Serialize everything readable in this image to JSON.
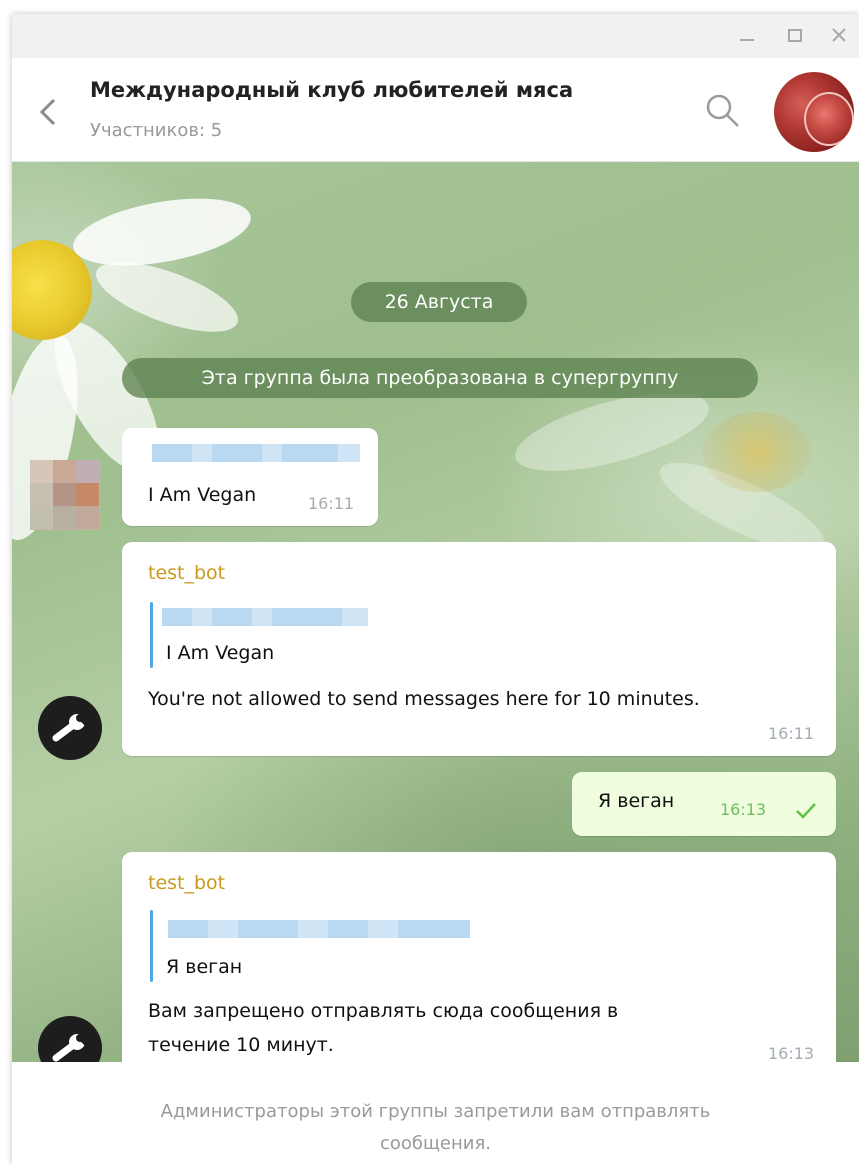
{
  "window": {
    "controls": [
      "minimize",
      "maximize",
      "close"
    ]
  },
  "header": {
    "title": "Международный клуб любителей мяса",
    "subtitle": "Участников: 5",
    "back_icon": "chevron-left-icon",
    "search_icon": "search-icon"
  },
  "chat": {
    "date_label": "26 Августа",
    "service_message": "Эта группа была преобразована в супергруппу",
    "messages": [
      {
        "text": "I Am Vegan",
        "time": "16:11"
      },
      {
        "sender": "test_bot",
        "reply_text": "I Am Vegan",
        "text": "You're not allowed to send messages here for 10 minutes.",
        "time": "16:11"
      },
      {
        "text": "Я веган",
        "time": "16:13"
      },
      {
        "sender": "test_bot",
        "reply_text": "Я веган",
        "text_line1": "Вам запрещено отправлять сюда сообщения в",
        "text_line2": "течение 10 минут.",
        "time": "16:13"
      }
    ]
  },
  "footer": {
    "notice_line1": "Администраторы этой группы запретили вам отправлять",
    "notice_line2": "сообщения."
  },
  "colors": {
    "sender_name": "#c89b1f",
    "reply_bar": "#4fa6e6",
    "outgoing_bubble": "#effdde",
    "check": "#5ec245",
    "pill_bg": "#5c8250"
  }
}
